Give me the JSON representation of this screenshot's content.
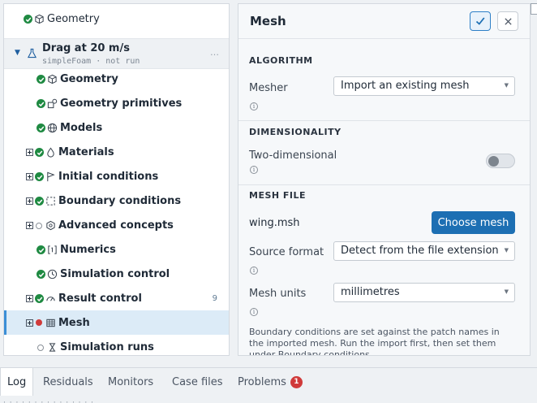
{
  "tree": {
    "top_item": {
      "label": "Geometry",
      "status": "done",
      "icon": "cube-icon"
    },
    "case": {
      "title": "Drag at 20 m/s",
      "subtitle": "simpleFoam · not run",
      "more": "…",
      "icon": "flask-icon"
    },
    "items": [
      {
        "label": "Geometry",
        "icon": "cube-icon",
        "status": "done",
        "expandable": false
      },
      {
        "label": "Geometry primitives",
        "icon": "shapes-icon",
        "status": "done",
        "expandable": false
      },
      {
        "label": "Models",
        "icon": "globe-icon",
        "status": "done",
        "expandable": false
      },
      {
        "label": "Materials",
        "icon": "droplet-icon",
        "status": "done",
        "expandable": true
      },
      {
        "label": "Initial conditions",
        "icon": "flag-icon",
        "status": "done",
        "expandable": true
      },
      {
        "label": "Boundary conditions",
        "icon": "boundary-icon",
        "status": "done",
        "expandable": true
      },
      {
        "label": "Advanced concepts",
        "icon": "hexagon-icon",
        "status": "pending",
        "expandable": true
      },
      {
        "label": "Numerics",
        "icon": "numerics-icon",
        "status": "done",
        "expandable": false
      },
      {
        "label": "Simulation control",
        "icon": "clock-icon",
        "status": "done",
        "expandable": false
      },
      {
        "label": "Result control",
        "icon": "gauge-icon",
        "status": "done",
        "expandable": true,
        "count": "9"
      },
      {
        "label": "Mesh",
        "icon": "grid-icon",
        "status": "error",
        "expandable": true,
        "selected": true
      },
      {
        "label": "Simulation runs",
        "icon": "runs-icon",
        "status": "pending",
        "expandable": false
      }
    ]
  },
  "panel": {
    "title": "Mesh",
    "confirm_icon": "check-icon",
    "close_icon": "close-icon",
    "sections": {
      "algorithm": "ALGORITHM",
      "dimensionality": "DIMENSIONALITY",
      "mesh_file": "MESH FILE"
    },
    "mesher": {
      "label": "Mesher",
      "value": "Import an existing mesh"
    },
    "two_dimensional": {
      "label": "Two-dimensional",
      "on": false
    },
    "file": {
      "name": "wing.msh",
      "button": "Choose mesh"
    },
    "source_format": {
      "label": "Source format",
      "value": "Detect from the file extension"
    },
    "mesh_units": {
      "label": "Mesh units",
      "value": "millimetres"
    },
    "note": "Boundary conditions are set against the patch names in the imported mesh. Run the import first, then set them under Boundary conditions."
  },
  "bottom_tabs": [
    {
      "label": "Log",
      "active": true
    },
    {
      "label": "Residuals"
    },
    {
      "label": "Monitors"
    },
    {
      "label": "Case files"
    },
    {
      "label": "Problems",
      "badge": "1"
    }
  ],
  "log_line": "· · · · · · · · · · · · · · ·",
  "colors": {
    "accent": "#1d6fb3",
    "done": "#1f8a42",
    "error": "#d03a3a",
    "selection": "#dcebf7"
  }
}
